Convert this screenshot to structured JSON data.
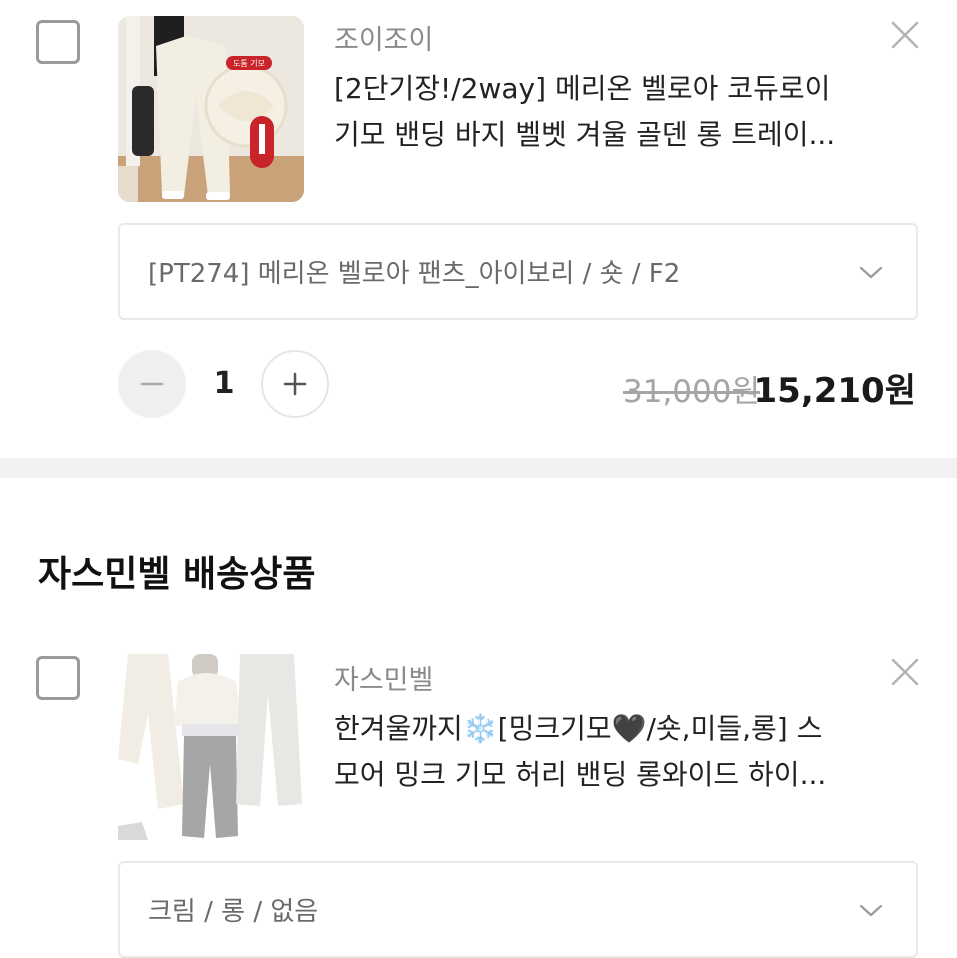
{
  "item1": {
    "brand": "조이조이",
    "title_line1": "[2단기장!/2way] 메리온 벨로아 코듀로이",
    "title_line2": "기모 밴딩 바지 벨벳 겨울 골덴 롱 트레이...",
    "badge_text": "도톰 기모",
    "option": "[PT274] 메리온 벨로아 팬츠_아이보리 / 숏 / F2",
    "quantity": "1",
    "price_original": "31,000원",
    "price_sale": "15,210원"
  },
  "section": {
    "title": "자스민벨 배송상품"
  },
  "item2": {
    "brand": "자스민벨",
    "title_line1": "한겨울까지❄️[밍크기모🖤/숏,미들,롱] 스",
    "title_line2": "모어 밍크 기모 허리 밴딩 롱와이드 하이...",
    "option": "크림 / 롱 / 없음"
  },
  "icons": {
    "checkbox": "checkbox-icon",
    "close": "close-icon",
    "chevron": "chevron-down-icon",
    "minus": "minus-icon",
    "plus": "plus-icon"
  },
  "colors": {
    "divider": "#f2f2f2",
    "muted_text": "#8a8a8a",
    "sale_price": "#1a1a1a"
  }
}
